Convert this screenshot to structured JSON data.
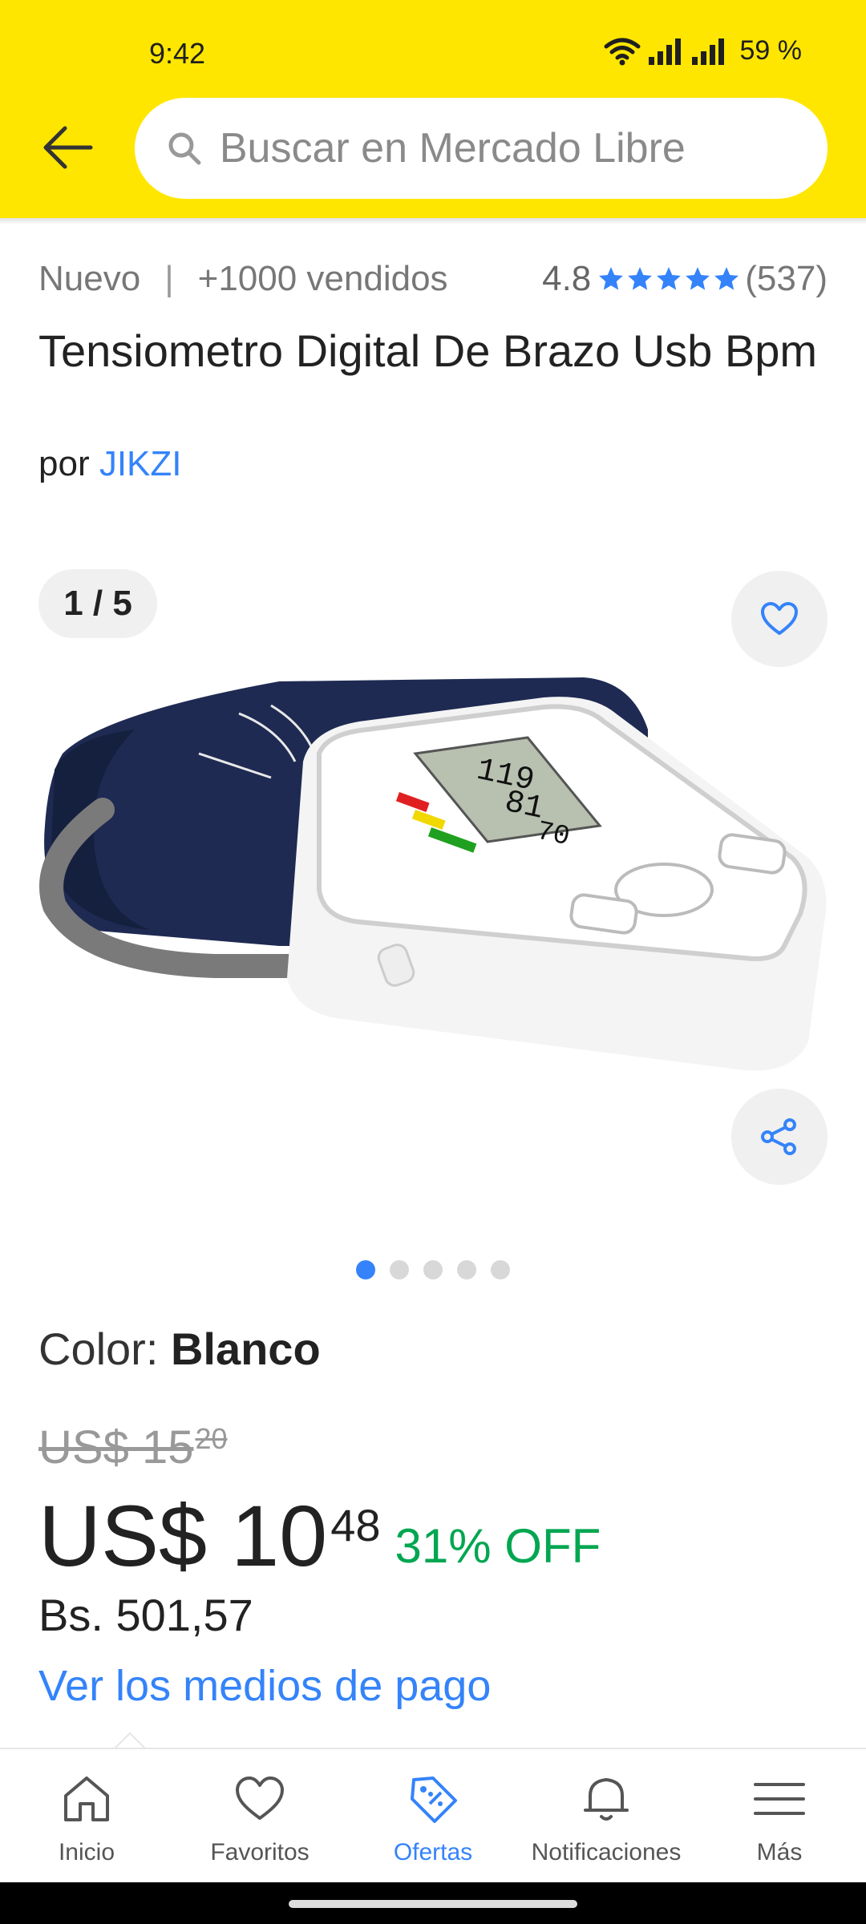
{
  "status_bar": {
    "time": "9:42",
    "battery": "59 %"
  },
  "search": {
    "placeholder": "Buscar en Mercado Libre"
  },
  "product": {
    "condition": "Nuevo",
    "separator": "|",
    "sold": "+1000 vendidos",
    "rating": "4.8",
    "stars": 5,
    "reviews": "(537)",
    "title": "Tensiometro Digital De Brazo Usb Bpm",
    "by_prefix": "por",
    "brand": "JIKZI"
  },
  "gallery": {
    "counter": "1 / 5",
    "total": 5,
    "active_index": 0,
    "screen_values": {
      "sys": "119",
      "dia": "81",
      "pul": "70"
    }
  },
  "color": {
    "label": "Color:",
    "value": "Blanco"
  },
  "pricing": {
    "old_whole": "US$ 15",
    "old_cents": "20",
    "whole": "US$ 10",
    "cents": "48",
    "discount": "31% OFF",
    "local_price": "Bs. 501,57",
    "payment_link": "Ver los medios de pago"
  },
  "bottom_nav": {
    "items": [
      {
        "label": "Inicio",
        "icon": "home-icon",
        "active": false
      },
      {
        "label": "Favoritos",
        "icon": "heart-icon",
        "active": false
      },
      {
        "label": "Ofertas",
        "icon": "tag-icon",
        "active": true
      },
      {
        "label": "Notificaciones",
        "icon": "bell-icon",
        "active": false
      },
      {
        "label": "Más",
        "icon": "menu-icon",
        "active": false
      }
    ]
  },
  "colors": {
    "header": "#ffe600",
    "link": "#3483fa",
    "discount": "#00a650"
  }
}
